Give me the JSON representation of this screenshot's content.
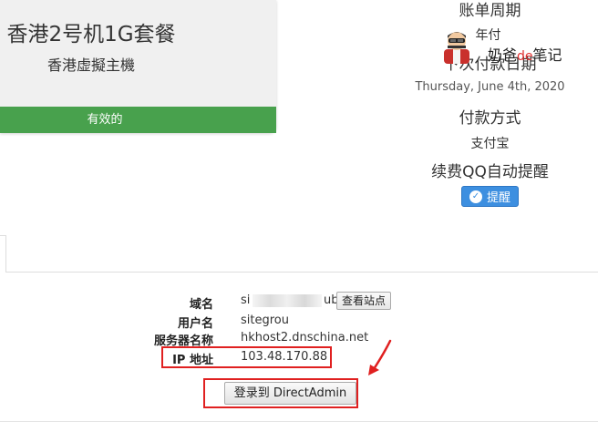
{
  "product": {
    "name": "香港2号机1G套餐",
    "type": "香港虚擬主機",
    "status": "有效的"
  },
  "billing": {
    "cycle_label": "账单周期",
    "cycle_value": "年付",
    "next_due_label": "下次付款日期",
    "next_due_value": "Thursday, June 4th, 2020",
    "payment_method_label": "付款方式",
    "payment_method_value": "支付宝",
    "qq_reminder_label": "续费QQ自动提醒",
    "remind_button": "提醒",
    "remind_icon": "check-icon"
  },
  "watermark": {
    "text_before": "奶爸",
    "text_red": "de",
    "text_after": "笔记"
  },
  "account": {
    "domain_label": "域名",
    "domain_value_prefix": "si",
    "domain_value_suffix": "ub",
    "view_site_button": "查看站点",
    "username_label": "用户名",
    "username_value": "sitegrou",
    "server_label": "服务器名称",
    "server_value": "hkhost2.dnschina.net",
    "ip_label": "IP 地址",
    "ip_value": "103.48.170.88",
    "login_button": "登录到 DirectAdmin"
  },
  "colors": {
    "status_green": "#48a14d",
    "button_blue": "#3d8fe0",
    "highlight_red": "#e02020"
  }
}
